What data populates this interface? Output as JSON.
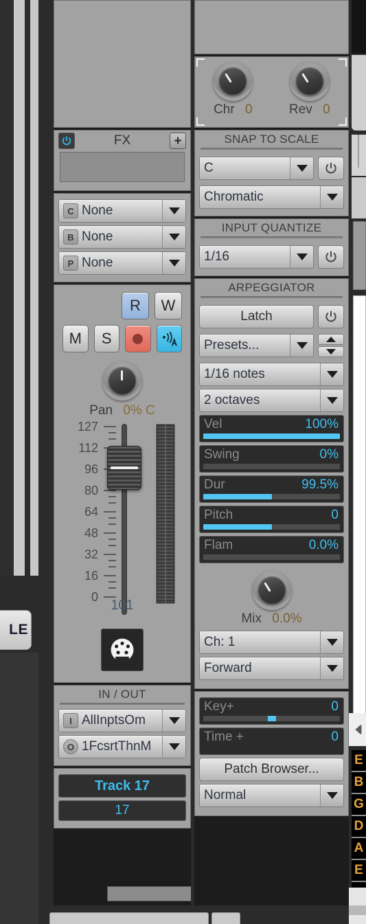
{
  "left_tab": {
    "label": "LE"
  },
  "fx_panel": {
    "title": "FX",
    "power_icon": "power-icon",
    "add_icon": "plus-icon"
  },
  "insert_slots": [
    {
      "badge": "C",
      "value": "None"
    },
    {
      "badge": "B",
      "value": "None"
    },
    {
      "badge": "P",
      "value": "None"
    }
  ],
  "transport": {
    "read_label": "R",
    "write_label": "W",
    "mute_label": "M",
    "solo_label": "S",
    "record_icon": "record-icon",
    "input_echo_icon": "input-echo-icon"
  },
  "pan": {
    "label": "Pan",
    "value": "0% C"
  },
  "fader": {
    "scale_ticks": [
      "127",
      "112",
      "96",
      "80",
      "64",
      "48",
      "32",
      "16",
      "0"
    ],
    "volume": "101",
    "midi_icon": "midi-din-icon"
  },
  "in_out": {
    "title": "IN / OUT",
    "input": {
      "badge": "I",
      "value": "AllInptsOm"
    },
    "output": {
      "badge": "O",
      "value": "1FcsrtThnM"
    },
    "track_name": "Track 17",
    "track_number": "17"
  },
  "chorus_reverb": {
    "chorus": {
      "label": "Chr",
      "value": "0",
      "icon": "knob-icon"
    },
    "reverb": {
      "label": "Rev",
      "value": "0",
      "icon": "knob-icon"
    }
  },
  "snap_to_scale": {
    "title": "SNAP TO SCALE",
    "root": "C",
    "scale": "Chromatic",
    "power_icon": "power-icon"
  },
  "input_quantize": {
    "title": "INPUT QUANTIZE",
    "resolution": "1/16",
    "power_icon": "power-icon"
  },
  "arpeggiator": {
    "title": "ARPEGGIATOR",
    "latch_label": "Latch",
    "power_icon": "power-icon",
    "presets_label": "Presets...",
    "spinner_icon": "spinner-icon",
    "rate": "1/16 notes",
    "range": "2 octaves",
    "params": [
      {
        "label": "Vel",
        "value": "100%",
        "fill_pct": 100
      },
      {
        "label": "Swing",
        "value": "0%",
        "fill_pct": 0
      },
      {
        "label": "Dur",
        "value": "99.5%",
        "fill_pct": 50
      },
      {
        "label": "Pitch",
        "value": "0",
        "fill_pct": 50
      },
      {
        "label": "Flam",
        "value": "0.0%",
        "fill_pct": 0
      }
    ],
    "mix": {
      "label": "Mix",
      "value": "0.0%",
      "icon": "knob-icon"
    },
    "channel": "Ch: 1",
    "direction": "Forward"
  },
  "patch": {
    "key_plus": {
      "label": "Key+",
      "value": "0",
      "thumb_pct": 50
    },
    "time_plus": {
      "label": "Time +",
      "value": "0"
    },
    "browser_label": "Patch Browser...",
    "mode": "Normal"
  },
  "string_labels": [
    "E",
    "B",
    "G",
    "D",
    "A",
    "E"
  ],
  "right_edge": {
    "collapse_icon": "collapse-left-icon"
  },
  "colors": {
    "accent_blue": "#41bff0",
    "panel_gray": "#a2a2a2",
    "record_red": "#e06a5c",
    "read_blue": "#93b3dd",
    "string_orange": "#e8a23a"
  }
}
